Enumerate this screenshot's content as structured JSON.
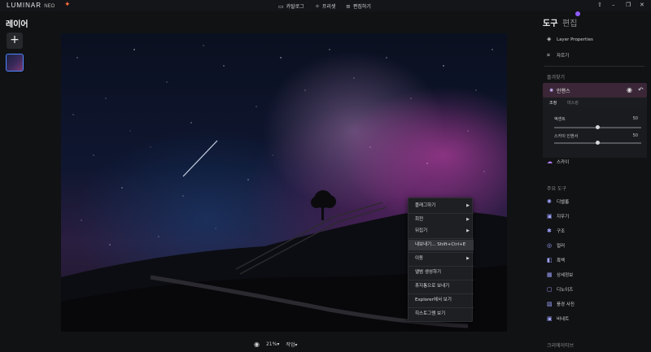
{
  "app": {
    "logo": "LUMINAR",
    "logo_suffix": "NEO"
  },
  "nav": [
    {
      "label": "카탈로그",
      "icon": "folder-icon"
    },
    {
      "label": "프리셋",
      "icon": "sparkle-icon"
    },
    {
      "label": "편집하기",
      "icon": "sliders-icon"
    }
  ],
  "left_panel": {
    "title": "레이어",
    "add": "+"
  },
  "bottom_bar": {
    "zoom": "21%",
    "zoom_caret": "▾",
    "action": "작업",
    "action_caret": "▾"
  },
  "right_panel": {
    "tab_tools": "도구",
    "tab_edit": "편집",
    "layer_properties": "Layer Properties",
    "crop": "자르기",
    "favorites_title": "즐겨찾기",
    "enhance": "인핸스",
    "sub_tab_adjust": "조정",
    "sub_tab_mask": "마스킹",
    "sliders": [
      {
        "label": "액센트",
        "value": 50,
        "display": "50"
      },
      {
        "label": "스카이 인핸서",
        "value": 50,
        "display": "50"
      }
    ],
    "sky": "스카이",
    "essential_title": "주요 도구",
    "tools": [
      {
        "label": "디벨롭",
        "icon": "develop-icon"
      },
      {
        "label": "지우기",
        "icon": "erase-icon"
      },
      {
        "label": "구조",
        "icon": "structure-icon"
      },
      {
        "label": "컬러",
        "icon": "color-icon"
      },
      {
        "label": "흑백",
        "icon": "bw-icon"
      },
      {
        "label": "상세정보",
        "icon": "details-icon"
      },
      {
        "label": "디노이즈",
        "icon": "denoise-icon"
      },
      {
        "label": "풍경 사진",
        "icon": "landscape-icon"
      },
      {
        "label": "비네트",
        "icon": "vignette-icon"
      }
    ],
    "creative_title": "크리에이티브"
  },
  "context_menu": [
    {
      "label": "플래그하기",
      "submenu": true
    },
    {
      "label": "회전",
      "submenu": true
    },
    {
      "label": "뒤집기",
      "submenu": true
    },
    {
      "label": "내보내기... Shift+Ctrl+E",
      "submenu": false,
      "highlighted": true
    },
    {
      "label": "이동",
      "submenu": true
    },
    {
      "label": "앨범 생성하기",
      "submenu": false
    },
    {
      "label": "휴지통으로 보내기",
      "submenu": false
    },
    {
      "label": "Explorer에서 보기",
      "submenu": false
    },
    {
      "label": "히스토그램 보기",
      "submenu": false
    }
  ],
  "colors": {
    "accent": "#4b86ff",
    "enhance_bg": "#3a2636",
    "tab_dot": "#8e5cff"
  }
}
